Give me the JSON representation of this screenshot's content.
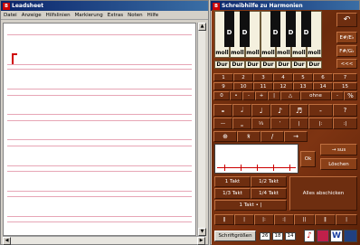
{
  "leadsheet": {
    "title": "Leadsheet",
    "menu": [
      "Datei",
      "Anzeige",
      "Hilfslinien",
      "Markierung",
      "Extras",
      "Noten",
      "Hilfe"
    ]
  },
  "helper": {
    "title": "Schreibhilfe zu Harmonien",
    "keys": [
      {
        "label": "D",
        "minor": "moll",
        "major": "Dur"
      },
      {
        "label": "D",
        "minor": "moll",
        "major": "Dur"
      },
      {
        "label": "",
        "minor": "moll",
        "major": "Dur"
      },
      {
        "label": "D",
        "minor": "moll",
        "major": "Dur"
      },
      {
        "label": "D",
        "minor": "moll",
        "major": "Dur"
      },
      {
        "label": "D",
        "minor": "moll",
        "major": "Dur"
      },
      {
        "label": "",
        "minor": "moll",
        "major": "Dur"
      }
    ],
    "side_buttons": [
      "↶",
      "E#/E♭",
      "F#/G♭",
      "<<<"
    ],
    "num_row1": [
      "1",
      "2",
      "3",
      "4",
      "5",
      "6",
      "7"
    ],
    "num_row2": [
      "9",
      "10",
      "11",
      "12",
      "13",
      "14",
      "15"
    ],
    "num_row3": [
      "0",
      "•",
      "-",
      "+",
      "|",
      "△",
      "ohne",
      "-",
      "%"
    ],
    "note_row1": [
      "𝅝",
      "𝅗𝅥",
      "♩",
      "♪",
      "♬",
      "-",
      "?"
    ],
    "note_row2": [
      "—",
      "‗",
      "⅓",
      "‘",
      "|",
      "|:",
      ":|"
    ],
    "symbol_row": [
      "⊕",
      "𝄋",
      "/",
      "→"
    ],
    "sus_label": "→ sus",
    "ok_label": "Ok",
    "loeschen_label": "Löschen",
    "takt_buttons": [
      "1 Takt",
      "1/2 Takt",
      "1/3 Takt",
      "1/4 Takt",
      "1 Takt • |"
    ],
    "send_all_label": "Alles abschicken",
    "bar_row": [
      "‖",
      "|",
      "|:",
      ":|",
      "||",
      "‖",
      "|"
    ],
    "schrift_label": "Schriftgrößen",
    "font_sizes": [
      "26",
      "18",
      "14"
    ]
  }
}
